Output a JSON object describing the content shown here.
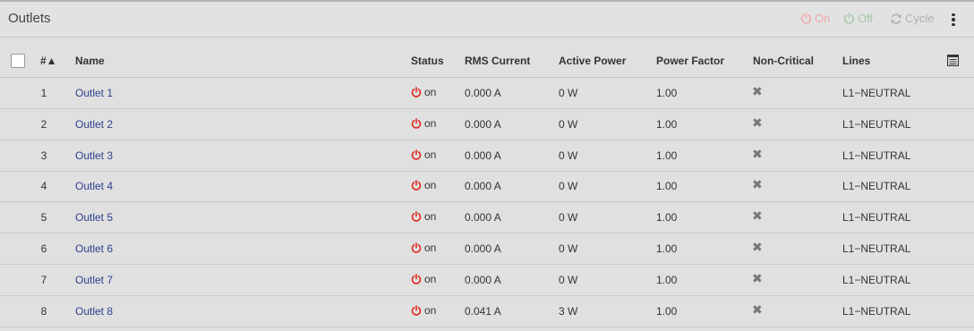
{
  "panel": {
    "title": "Outlets"
  },
  "toolbar": {
    "on_label": "On",
    "off_label": "Off",
    "cycle_label": "Cycle",
    "on_color": "#f0a8a8",
    "off_color": "#a8c8a8",
    "cycle_color": "#b0b0b0"
  },
  "table": {
    "headers": {
      "num": "#▲",
      "name": "Name",
      "status": "Status",
      "rms": "RMS Current",
      "active": "Active Power",
      "pf": "Power Factor",
      "noncritical": "Non-Critical",
      "lines": "Lines"
    },
    "rows": [
      {
        "num": "1",
        "name": "Outlet 1",
        "status": "on",
        "rms": "0.000 A",
        "active": "0 W",
        "pf": "1.00",
        "noncritical": "✖",
        "lines": "L1−NEUTRAL"
      },
      {
        "num": "2",
        "name": "Outlet 2",
        "status": "on",
        "rms": "0.000 A",
        "active": "0 W",
        "pf": "1.00",
        "noncritical": "✖",
        "lines": "L1−NEUTRAL"
      },
      {
        "num": "3",
        "name": "Outlet 3",
        "status": "on",
        "rms": "0.000 A",
        "active": "0 W",
        "pf": "1.00",
        "noncritical": "✖",
        "lines": "L1−NEUTRAL"
      },
      {
        "num": "4",
        "name": "Outlet 4",
        "status": "on",
        "rms": "0.000 A",
        "active": "0 W",
        "pf": "1.00",
        "noncritical": "✖",
        "lines": "L1−NEUTRAL"
      },
      {
        "num": "5",
        "name": "Outlet 5",
        "status": "on",
        "rms": "0.000 A",
        "active": "0 W",
        "pf": "1.00",
        "noncritical": "✖",
        "lines": "L1−NEUTRAL"
      },
      {
        "num": "6",
        "name": "Outlet 6",
        "status": "on",
        "rms": "0.000 A",
        "active": "0 W",
        "pf": "1.00",
        "noncritical": "✖",
        "lines": "L1−NEUTRAL"
      },
      {
        "num": "7",
        "name": "Outlet 7",
        "status": "on",
        "rms": "0.000 A",
        "active": "0 W",
        "pf": "1.00",
        "noncritical": "✖",
        "lines": "L1−NEUTRAL"
      },
      {
        "num": "8",
        "name": "Outlet 8",
        "status": "on",
        "rms": "0.041 A",
        "active": "3 W",
        "pf": "1.00",
        "noncritical": "✖",
        "lines": "L1−NEUTRAL"
      }
    ]
  },
  "colors": {
    "status_on": "#e0241a",
    "link": "#2d3f8c"
  },
  "icons": {
    "power": "power-icon",
    "cycle": "refresh-icon",
    "menu": "kebab-menu-icon",
    "columns": "column-chooser-icon",
    "noncritical": "x-icon"
  }
}
